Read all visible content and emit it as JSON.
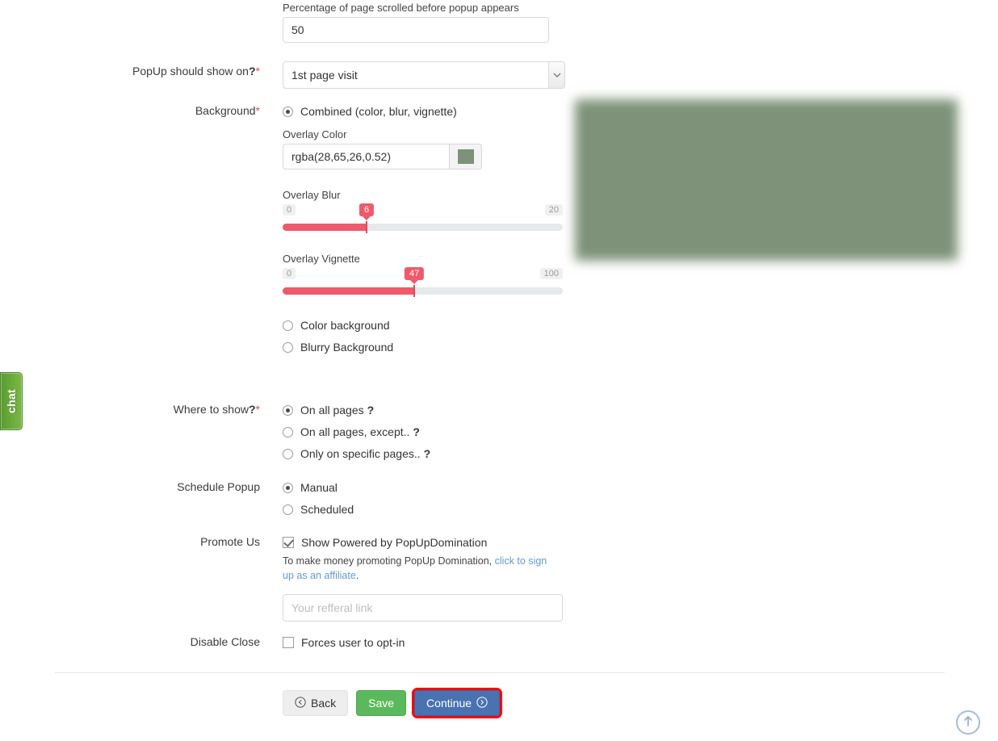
{
  "chat_tab": {
    "label": "chat"
  },
  "fields": {
    "scroll_percentage": {
      "label": "Percentage of page scrolled before popup appears",
      "value": "50"
    },
    "show_on": {
      "label": "PopUp should show on",
      "help": "?",
      "required": "*",
      "value": "1st page visit",
      "options": [
        "1st page visit"
      ]
    },
    "background": {
      "label": "Background",
      "required": "*",
      "options": [
        {
          "label": "Combined (color, blur, vignette)",
          "selected": true
        },
        {
          "label": "Color background",
          "selected": false
        },
        {
          "label": "Blurry Background",
          "selected": false
        }
      ],
      "overlay_color": {
        "label": "Overlay Color",
        "value": "rgba(28,65,26,0.52)",
        "swatch_hex": "#7d9279"
      },
      "overlay_blur": {
        "label": "Overlay Blur",
        "min": "0",
        "max": "20",
        "value": "6",
        "percent": 30
      },
      "overlay_vignette": {
        "label": "Overlay Vignette",
        "min": "0",
        "max": "100",
        "value": "47",
        "percent": 47
      }
    },
    "where_to_show": {
      "label": "Where to show",
      "help": "?",
      "required": "*",
      "options": [
        {
          "label": "On all pages",
          "help": "?",
          "selected": true
        },
        {
          "label": "On all pages, except..",
          "help": "?",
          "selected": false
        },
        {
          "label": "Only on specific pages..",
          "help": "?",
          "selected": false
        }
      ]
    },
    "schedule_popup": {
      "label": "Schedule Popup",
      "options": [
        {
          "label": "Manual",
          "selected": true
        },
        {
          "label": "Scheduled",
          "selected": false
        }
      ]
    },
    "promote_us": {
      "label": "Promote Us",
      "checkbox_label": "Show Powered by PopUpDomination",
      "checked": true,
      "note_before": "To make money promoting PopUp Domination, ",
      "note_link": "click to sign up as an affiliate",
      "note_after": ".",
      "referral_placeholder": "Your refferal link",
      "referral_value": ""
    },
    "disable_close": {
      "label": "Disable Close",
      "checkbox_label": "Forces user to opt-in",
      "checked": false
    }
  },
  "preview": {
    "background_hex": "#7d9279"
  },
  "actions": {
    "back": "Back",
    "save": "Save",
    "continue": "Continue",
    "highlight_hex": "#fe0000"
  },
  "to_top": {
    "title": "Back to top"
  }
}
